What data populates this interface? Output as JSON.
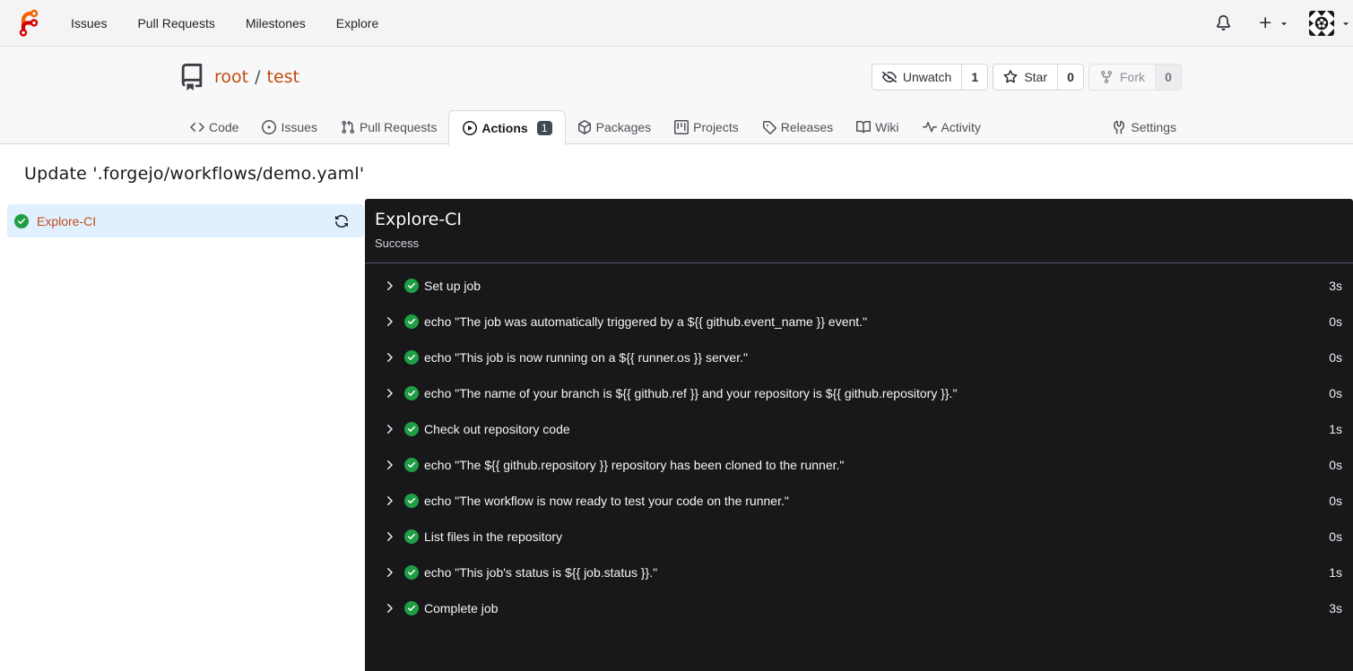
{
  "navbar": {
    "logo": "forgejo",
    "links": [
      {
        "label": "Issues"
      },
      {
        "label": "Pull Requests"
      },
      {
        "label": "Milestones"
      },
      {
        "label": "Explore"
      }
    ],
    "icons": [
      "bell-icon",
      "plus-icon",
      "caret-down-icon",
      "avatar"
    ]
  },
  "repo": {
    "owner": "root",
    "separator": "/",
    "name": "test",
    "buttons": {
      "unwatch": {
        "label": "Unwatch",
        "count": "1"
      },
      "star": {
        "label": "Star",
        "count": "0"
      },
      "fork": {
        "label": "Fork",
        "count": "0"
      }
    },
    "tabs": {
      "code": "Code",
      "issues": "Issues",
      "pull_requests": "Pull Requests",
      "actions": "Actions",
      "actions_badge": "1",
      "packages": "Packages",
      "projects": "Projects",
      "releases": "Releases",
      "wiki": "Wiki",
      "activity": "Activity",
      "settings": "Settings"
    }
  },
  "run": {
    "title": "Update '.forgejo/workflows/demo.yaml'",
    "job": {
      "name": "Explore-CI",
      "status_icon": "success"
    },
    "panel": {
      "title": "Explore-CI",
      "status": "Success",
      "steps": [
        {
          "name": "Set up job",
          "duration": "3s"
        },
        {
          "name": "echo \"The job was automatically triggered by a ${{ github.event_name }} event.\"",
          "duration": "0s"
        },
        {
          "name": "echo \"This job is now running on a ${{ runner.os }} server.\"",
          "duration": "0s"
        },
        {
          "name": "echo \"The name of your branch is ${{ github.ref }} and your repository is ${{ github.repository }}.\"",
          "duration": "0s"
        },
        {
          "name": "Check out repository code",
          "duration": "1s"
        },
        {
          "name": "echo \"The ${{ github.repository }} repository has been cloned to the runner.\"",
          "duration": "0s"
        },
        {
          "name": "echo \"The workflow is now ready to test your code on the runner.\"",
          "duration": "0s"
        },
        {
          "name": "List files in the repository",
          "duration": "0s"
        },
        {
          "name": "echo \"This job's status is ${{ job.status }}.\"",
          "duration": "1s"
        },
        {
          "name": "Complete job",
          "duration": "3s"
        }
      ]
    }
  },
  "colors": {
    "accent_orange": "#bf4a0e",
    "success_green": "#1f9e45",
    "console_bg": "#18181a",
    "selected_job_bg": "#e0f0ff",
    "badge_bg": "#404a57"
  }
}
